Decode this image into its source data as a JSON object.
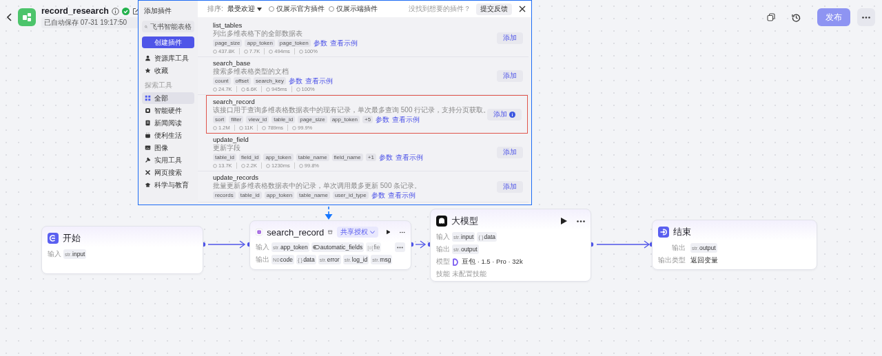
{
  "header": {
    "title": "record_research",
    "saved": "已自动保存 07-31 19:17:50",
    "publish": {
      "label": "发布",
      "disabled": true
    }
  },
  "plugin_dialog": {
    "title": "添加插件",
    "search": {
      "value": "飞书智能表格"
    },
    "create_button": "创建插件",
    "sidebar_items": [
      {
        "kind": "item",
        "label": "资源库工具",
        "selected": false
      },
      {
        "kind": "item",
        "label": "收藏",
        "selected": false
      },
      {
        "kind": "section",
        "label": "探索工具"
      },
      {
        "kind": "item",
        "label": "全部",
        "selected": true
      },
      {
        "kind": "item",
        "label": "智能硬件",
        "selected": false
      },
      {
        "kind": "item",
        "label": "新闻阅读",
        "selected": false
      },
      {
        "kind": "item",
        "label": "便利生活",
        "selected": false
      },
      {
        "kind": "item",
        "label": "图像",
        "selected": false
      },
      {
        "kind": "item",
        "label": "实用工具",
        "selected": false
      },
      {
        "kind": "item",
        "label": "网页搜索",
        "selected": false
      },
      {
        "kind": "item",
        "label": "科学与教育",
        "selected": false
      }
    ],
    "sort_label": "排序:",
    "sort_value": "最受欢迎",
    "filters": [
      {
        "label": "仅展示官方插件",
        "checked": false
      },
      {
        "label": "仅展示端插件",
        "checked": false
      }
    ],
    "feedback_hint": "没找到想要的插件？",
    "feedback_button": "提交反馈",
    "plugins": [
      {
        "name": "list_tables",
        "description": "列出多维表格下的全部数据表",
        "tags": [
          "page_size",
          "app_token",
          "page_token"
        ],
        "links": [
          "参数",
          "查看示例"
        ],
        "stats": [
          "437.8K",
          "7.7K",
          "494ms",
          "100%"
        ],
        "add_label": "添加",
        "highlighted": false
      },
      {
        "name": "search_base",
        "description": "搜索多维表格类型的文档",
        "tags": [
          "count",
          "offset",
          "search_key"
        ],
        "links": [
          "参数",
          "查看示例"
        ],
        "stats": [
          "24.7K",
          "6.6K",
          "945ms",
          "100%"
        ],
        "add_label": "添加",
        "highlighted": false
      },
      {
        "name": "search_record",
        "description": "该接口用于查询多维表格数据表中的现有记录，单次最多查询 500 行记录，支持分页获取。",
        "tags": [
          "sort",
          "filter",
          "view_id",
          "table_id",
          "page_size",
          "app_token",
          "+5"
        ],
        "links": [
          "参数",
          "查看示例"
        ],
        "stats": [
          "1.2M",
          "11K",
          "789ms",
          "99.9%"
        ],
        "add_label": "添加",
        "highlighted": true
      },
      {
        "name": "update_field",
        "description": "更新字段",
        "tags": [
          "table_id",
          "field_id",
          "app_token",
          "table_name",
          "field_name",
          "+1"
        ],
        "links": [
          "参数",
          "查看示例"
        ],
        "stats": [
          "13.7K",
          "2.2K",
          "1230ms",
          "99.8%"
        ],
        "add_label": "添加",
        "highlighted": false
      },
      {
        "name": "update_records",
        "description": "批量更新多维表格数据表中的记录，单次调用最多更新 500 条记录。",
        "tags": [
          "records",
          "table_id",
          "app_token",
          "table_name",
          "user_id_type"
        ],
        "links": [
          "参数",
          "查看示例"
        ],
        "add_label": "添加",
        "highlighted": false
      }
    ]
  },
  "nodes": [
    {
      "kind": "start",
      "title": "开始",
      "rows": [
        {
          "kind": "params",
          "label": "输入",
          "params": [
            {
              "type": "str.",
              "name": "input"
            }
          ]
        }
      ]
    },
    {
      "kind": "plugin",
      "title": "search_record",
      "tag": "共享授权",
      "rows": [
        {
          "kind": "params",
          "label": "输入",
          "params": [
            {
              "type": "str.",
              "name": "app_token"
            },
            {
              "kind": "bool",
              "name": "automatic_fields"
            },
            {
              "type": "[o]",
              "name": "fie",
              "faded": true
            }
          ],
          "more": true
        },
        {
          "kind": "params",
          "label": "输出",
          "params": [
            {
              "type": "N0",
              "name": "code"
            },
            {
              "type": "{ }",
              "name": "data"
            },
            {
              "type": "str.",
              "name": "error"
            },
            {
              "type": "str.",
              "name": "log_id"
            },
            {
              "type": "str.",
              "name": "msg"
            }
          ]
        }
      ]
    },
    {
      "kind": "llm",
      "title": "大模型",
      "rows": [
        {
          "kind": "params",
          "label": "输入",
          "params": [
            {
              "type": "str.",
              "name": "input"
            },
            {
              "type": "{ }",
              "name": "data"
            }
          ]
        },
        {
          "kind": "params",
          "label": "输出",
          "params": [
            {
              "type": "str.",
              "name": "output"
            }
          ]
        },
        {
          "kind": "model",
          "label": "模型",
          "value": "豆包 · 1.5 · Pro · 32k"
        },
        {
          "kind": "muted",
          "label": "技能",
          "value": "未配置技能"
        }
      ]
    },
    {
      "kind": "end",
      "title": "结束",
      "rows": [
        {
          "kind": "params",
          "label": "输出",
          "params": [
            {
              "type": "str.",
              "name": "output"
            }
          ]
        },
        {
          "kind": "text",
          "label": "输出类型",
          "value": "返回变量"
        }
      ]
    }
  ]
}
